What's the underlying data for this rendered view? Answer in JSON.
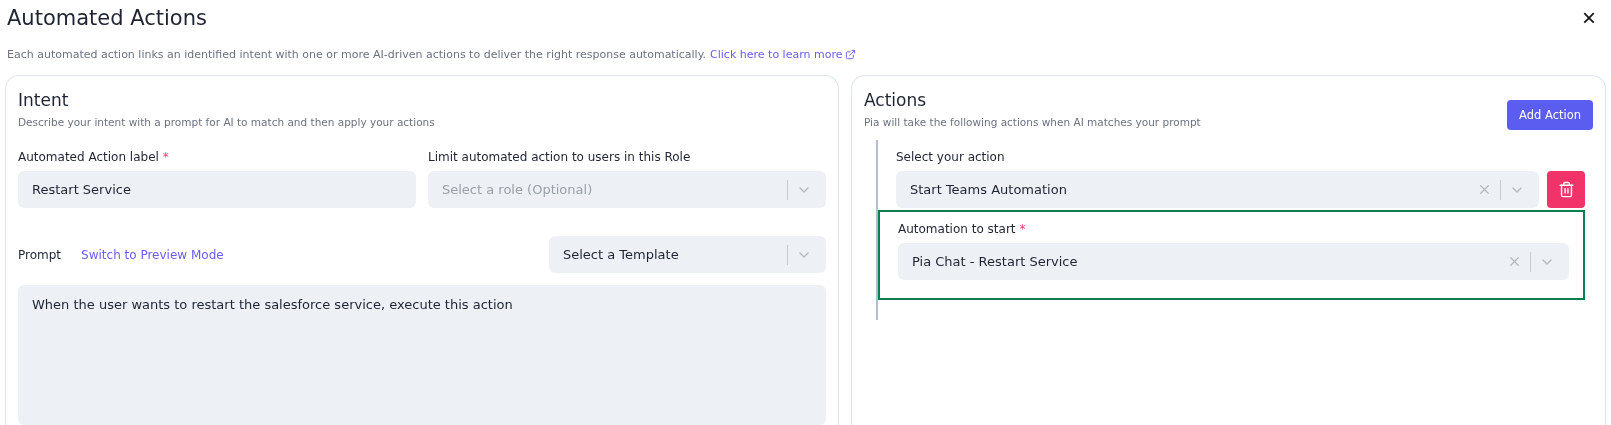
{
  "dialog": {
    "title": "Automated Actions",
    "close": "×",
    "description": "Each automated action links an identified intent with one or more AI-driven actions to deliver the right response automatically.",
    "learn_more_link": "Click here to learn more"
  },
  "intent": {
    "title": "Intent",
    "description": "Describe your intent with a prompt for AI to match and then apply your actions",
    "label_field": {
      "label": "Automated Action label",
      "required_mark": "*",
      "value": "Restart Service"
    },
    "role_field": {
      "label": "Limit automated action to users in this Role",
      "placeholder": "Select a role (Optional)"
    },
    "prompt": {
      "label": "Prompt",
      "mode_link": "Switch to Preview Mode",
      "template_select": "Select a Template",
      "value": "When the user wants to restart the salesforce service, execute this action"
    }
  },
  "actions": {
    "title": "Actions",
    "description": "Pia will take the following actions when AI matches your prompt",
    "add_button": "Add Action",
    "items": [
      {
        "label": "Select your action",
        "value": "Start Teams Automation",
        "sub_field": {
          "label": "Automation to start",
          "required_mark": "*",
          "value": "Pia Chat - Restart Service",
          "highlighted": true
        }
      }
    ]
  }
}
